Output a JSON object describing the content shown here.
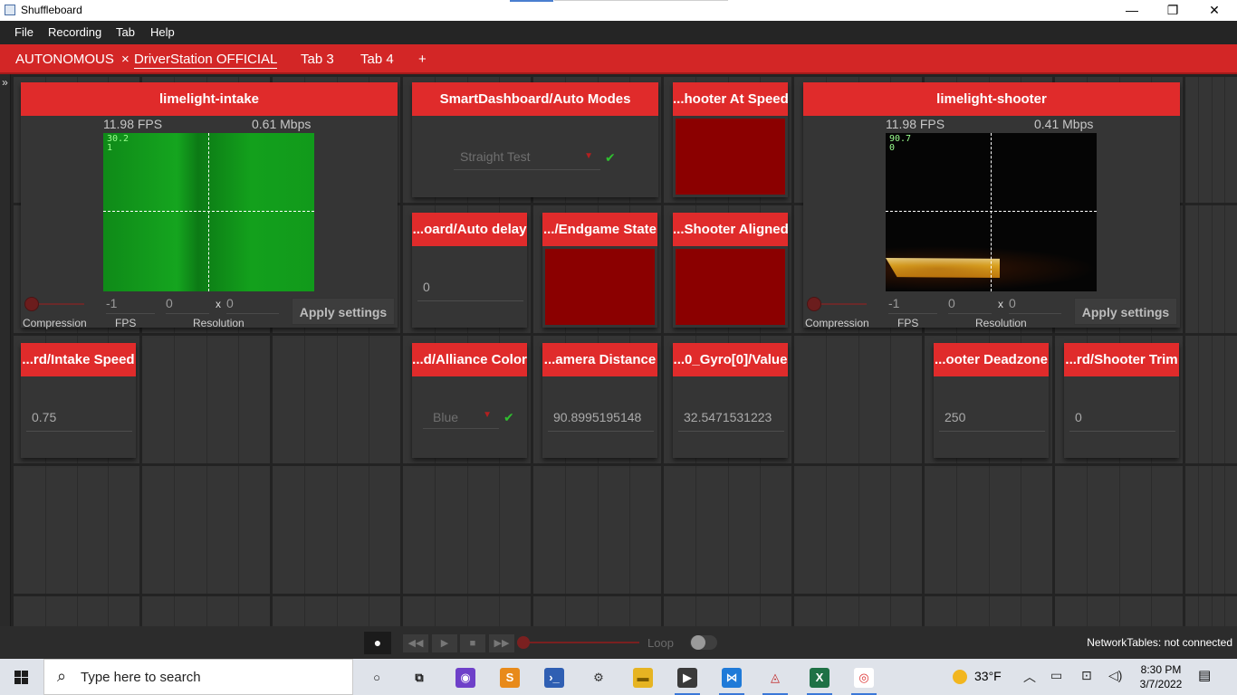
{
  "window": {
    "title": "Shuffleboard",
    "minimize": "—",
    "restore": "❐",
    "close": "✕"
  },
  "menu": [
    "File",
    "Recording",
    "Tab",
    "Help"
  ],
  "tabs": [
    {
      "label": "AUTONOMOUS",
      "active": false
    },
    {
      "label": "DriverStation OFFICIAL",
      "active": true,
      "close": "×"
    },
    {
      "label": "Tab 3",
      "active": false
    },
    {
      "label": "Tab 4",
      "active": false
    },
    {
      "label": "+",
      "active": false
    }
  ],
  "sidebar_toggle": "»",
  "widgets": {
    "limelight_intake": {
      "title": "limelight-intake",
      "fps": "11.98 FPS",
      "bandwidth": "0.61 Mbps",
      "overlay": [
        "30.2",
        "1"
      ],
      "fps_field": "-1",
      "res_w": "0",
      "res_x": "x",
      "res_h": "0",
      "label_compression": "Compression",
      "label_fps": "FPS",
      "label_resolution": "Resolution",
      "apply": "Apply settings"
    },
    "auto_modes": {
      "title": "SmartDashboard/Auto Modes",
      "selected": "Straight Test",
      "arrow": "▼",
      "check": "✔"
    },
    "shooter_at_speed": {
      "title": "...hooter At Speed"
    },
    "limelight_shooter": {
      "title": "limelight-shooter",
      "fps": "11.98 FPS",
      "bandwidth": "0.41 Mbps",
      "overlay": [
        "90.7",
        "0"
      ],
      "fps_field": "-1",
      "res_w": "0",
      "res_x": "x",
      "res_h": "0",
      "label_compression": "Compression",
      "label_fps": "FPS",
      "label_resolution": "Resolution",
      "apply": "Apply settings"
    },
    "auto_delay": {
      "title": "...oard/Auto delay",
      "value": "0"
    },
    "endgame_state": {
      "title": ".../Endgame State"
    },
    "shooter_aligned": {
      "title": "...Shooter Aligned"
    },
    "intake_speed": {
      "title": "...rd/Intake Speed",
      "value": "0.75"
    },
    "alliance_color": {
      "title": "...d/Alliance Color",
      "selected": "Blue",
      "arrow": "▼",
      "check": "✔"
    },
    "camera_distance": {
      "title": "...amera Distance",
      "value": "90.8995195148"
    },
    "gyro_value": {
      "title": "...0_Gyro[0]/Value",
      "value": "32.5471531223"
    },
    "shooter_deadzone": {
      "title": "...ooter Deadzone",
      "value": "250"
    },
    "shooter_trim": {
      "title": "...rd/Shooter Trim",
      "value": "0"
    }
  },
  "playback": {
    "record": "●",
    "rewind": "◀◀",
    "play": "▶",
    "stop": "■",
    "forward": "▶▶",
    "loop_label": "Loop",
    "network_status": "NetworkTables: not connected"
  },
  "taskbar": {
    "search_placeholder": "Type here to search",
    "search_icon": "⌕",
    "weather": "33°F",
    "time": "8:30 PM",
    "date": "3/7/2022",
    "apps": [
      {
        "icon": "cortana-icon",
        "glyph": "○"
      },
      {
        "icon": "task-view-icon",
        "glyph": "⧉"
      },
      {
        "icon": "github-desktop-icon",
        "glyph": "◉"
      },
      {
        "icon": "sublime-text-icon",
        "glyph": "S"
      },
      {
        "icon": "powershell-icon",
        "glyph": "›_"
      },
      {
        "icon": "settings-icon",
        "glyph": "⚙"
      },
      {
        "icon": "file-explorer-icon",
        "glyph": "▬"
      },
      {
        "icon": "driver-station-icon",
        "glyph": "▶"
      },
      {
        "icon": "vscode-icon",
        "glyph": "⋈"
      },
      {
        "icon": "shuffleboard-icon",
        "glyph": "◬"
      },
      {
        "icon": "excel-icon",
        "glyph": "X"
      },
      {
        "icon": "chrome-icon",
        "glyph": "◎"
      }
    ]
  },
  "colors": {
    "accent": "#e02b2b",
    "tab_bar": "#d32626",
    "boolean_false": "#8b0000",
    "check": "#2fbf2f"
  }
}
